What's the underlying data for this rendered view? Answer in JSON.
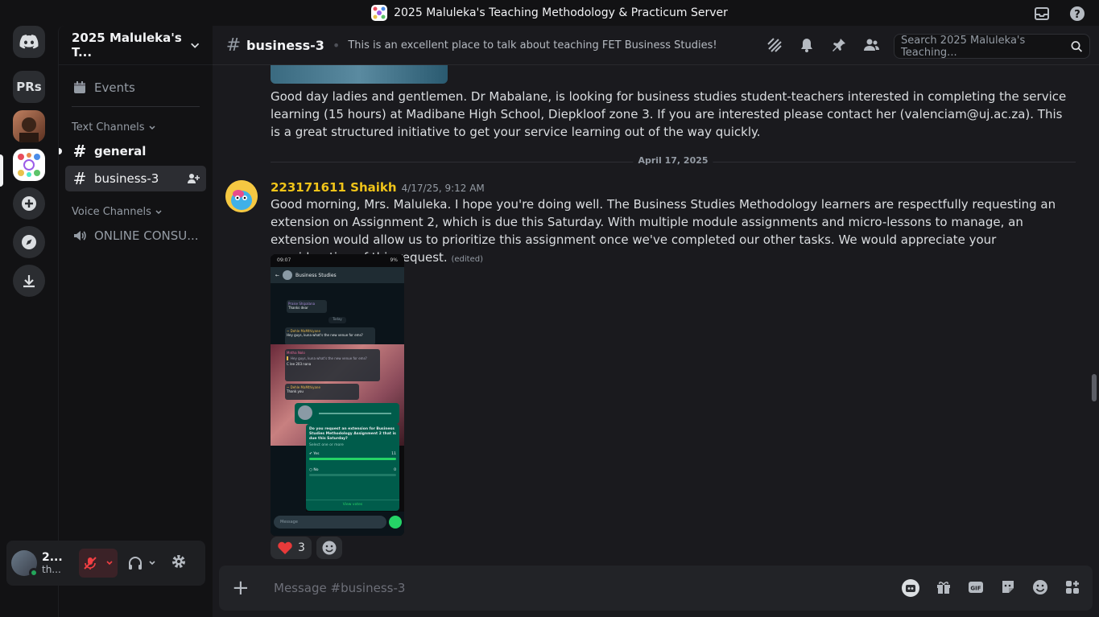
{
  "window": {
    "title": "2025 Maluleka's Teaching Methodology & Practicum Server"
  },
  "guilds": {
    "items": [
      {
        "label": "",
        "icon": "discord-logo-icon"
      },
      {
        "label": "PRs"
      },
      {
        "label": "",
        "icon": "avatar-guild"
      },
      {
        "label": "",
        "icon": "server-guild-active"
      },
      {
        "label": "",
        "icon": "add-server-icon"
      },
      {
        "label": "",
        "icon": "discover-icon"
      },
      {
        "label": "",
        "icon": "download-icon"
      }
    ]
  },
  "sidebar": {
    "server_name": "2025 Maluleka's T...",
    "events_label": "Events",
    "text_category": "Text Channels",
    "voice_category": "Voice Channels",
    "channels": [
      {
        "name": "general"
      },
      {
        "name": "business-3"
      }
    ],
    "voice_channel": "ONLINE CONSU..."
  },
  "user": {
    "name": "2...",
    "status": "th..."
  },
  "channel_header": {
    "name": "business-3",
    "topic": "This is an excellent place to talk about teaching FET Business Studies!",
    "search_placeholder": "Search 2025 Maluleka's Teaching..."
  },
  "messages": {
    "first": {
      "text": "Good day ladies and gentlemen. Dr Mabalane, is looking for business studies student-teachers interested in completing the service learning (15 hours) at Madibane High School, Diepkloof zone 3. If you are interested please contact her (valenciam@uj.ac.za). This is a great structured initiative to get your service learning out of the way quickly."
    },
    "date_divider": "April 17, 2025",
    "second": {
      "author": "223171611 Shaikh",
      "timestamp": "4/17/25, 9:12 AM",
      "text": "Good morning, Mrs. Maluleka. I hope you're doing well. The Business Studies Methodology learners are respectfully requesting an extension on Assignment 2, which is due this Saturday. With multiple module assignments and micro-lessons to manage, an extension would allow us to prioritize this assignment once we've completed our other tasks. We would appreciate your consideration of this request.",
      "edited": "(edited)",
      "reaction_count": "3"
    }
  },
  "phone_screenshot": {
    "time": "09:07",
    "battery": "9%",
    "chat_title": "Business Studies",
    "sender1": "Praise Shipalana",
    "msg1": "Thanks dear",
    "today": "Today",
    "sender2": "~ Dehle MaMthiyane",
    "phone2": "+27 72 731 0396",
    "msg2": "Hey guys, kuna what's the new venue for ems?",
    "sender3": "Mntha Nolo",
    "msg3": "C lee 203 nana",
    "msg4": "Thank you",
    "poll_question": "Do you request an extension for Business Studies Methodology Assignment 2 that is due this Saturday?",
    "poll_hint": "Select one or more",
    "opt_yes": "Yes",
    "yes_count": "11",
    "opt_no": "No",
    "no_count": "0",
    "view_votes": "View votes",
    "input_placeholder": "Message"
  },
  "composer": {
    "placeholder": "Message #business-3"
  }
}
